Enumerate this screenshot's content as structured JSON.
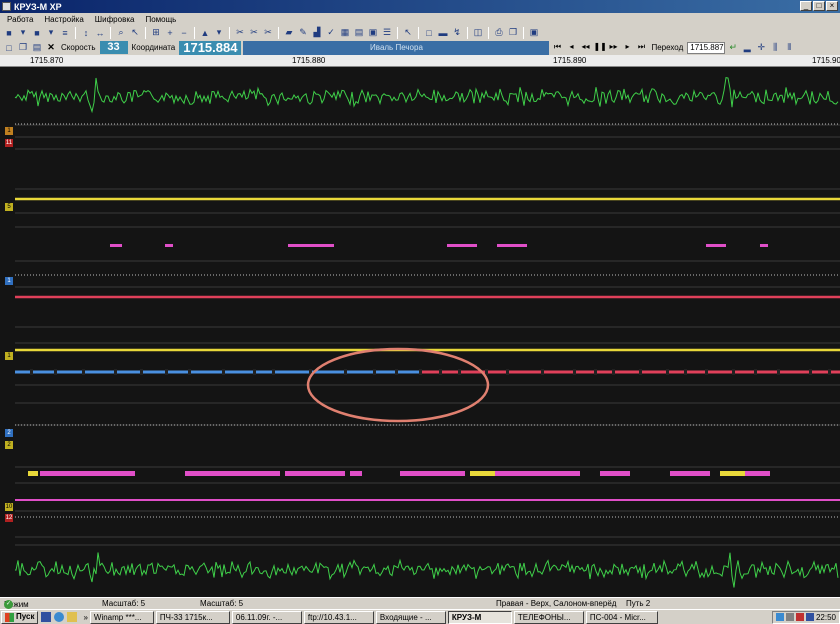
{
  "window": {
    "title": "КРУЗ-М XP"
  },
  "menu": [
    "Работа",
    "Настройка",
    "Шифровка",
    "Помощь"
  ],
  "toolbar2": {
    "speed_label": "Скорость",
    "speed_value": "33",
    "coord_label": "Координата",
    "coord_value": "1715.884",
    "status_text": "Иваль  Печора",
    "goto_label": "Переход",
    "goto_value": "1715.887"
  },
  "ruler": {
    "ticks": [
      "1715.870",
      "1715.880",
      "1715.890",
      "1715.90"
    ]
  },
  "channel_markers": [
    "1",
    "11",
    "5",
    "1",
    "1",
    "2",
    "2",
    "10",
    "12"
  ],
  "statusbar": {
    "mode_label": "Режим сдвига:",
    "scale1": "Масштаб: 5",
    "scale2": "Масштаб: 5",
    "orientation": "Правая - Верх, Салоном-вперёд",
    "path": "Путь 2"
  },
  "taskbar": {
    "start": "Пуск",
    "tasks": [
      "Winamp ***...",
      "ПЧ-33 1715к...",
      "06.11.09г. -...",
      "ftp://10.43.1...",
      "Входящие - ...",
      "КРУЗ-М",
      "ТЕЛЕФОНЫ...",
      "ПС-004 - Micr..."
    ],
    "active_task": "КРУЗ-М",
    "clock": "22:50"
  },
  "colors": {
    "titlebar": "#0a246a",
    "waveform": "#3fd04a",
    "yellow_line": "#e8d83a",
    "red_line": "#e0405a",
    "magenta_marks": "#e04fc8",
    "blue_line": "#4a90e0",
    "highlight_ellipse": "#e08070",
    "speed_box": "#3a8db0"
  }
}
